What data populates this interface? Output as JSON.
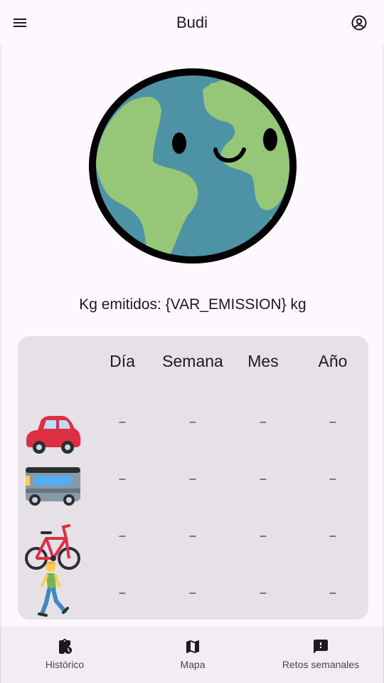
{
  "appbar": {
    "title": "Budi",
    "menu_icon": "menu-icon",
    "account_icon": "account-circle-icon"
  },
  "mascot": {
    "icon": "smiling-earth-icon",
    "colors": {
      "ocean": "#4d93a5",
      "land": "#95c776",
      "outline": "#000000"
    }
  },
  "emission": {
    "text": "Kg emitidos: {VAR_EMISSION} kg"
  },
  "table": {
    "headers": [
      "Día",
      "Semana",
      "Mes",
      "Año"
    ],
    "rows": [
      {
        "icon": "car-icon",
        "values": [
          "–",
          "–",
          "–",
          "–"
        ]
      },
      {
        "icon": "bus-icon",
        "values": [
          "–",
          "–",
          "–",
          "–"
        ]
      },
      {
        "icon": "bicycle-icon",
        "values": [
          "–",
          "–",
          "–",
          "–"
        ]
      },
      {
        "icon": "walking-person-icon",
        "values": [
          "–",
          "–",
          "–",
          "–"
        ]
      }
    ]
  },
  "bottom_nav": {
    "items": [
      {
        "label": "Histórico",
        "icon": "history-clipboard-icon"
      },
      {
        "label": "Mapa",
        "icon": "map-icon"
      },
      {
        "label": "Retos semanales",
        "icon": "report-icon"
      }
    ]
  }
}
